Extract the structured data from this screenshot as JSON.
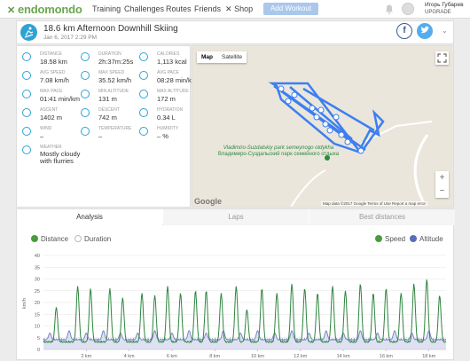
{
  "topbar": {
    "logo": "endomondo",
    "nav": [
      "Training",
      "Challenges",
      "Routes",
      "Friends",
      "Shop"
    ],
    "add_workout": "Add Workout",
    "user_name": "Игорь Губарев",
    "upgrade": "UPGRADE"
  },
  "workout": {
    "title": "18.6 km Afternoon Downhill Skiing",
    "date": "Jan 6, 2017 2:29 PM",
    "facebook": "f",
    "twitter": "t"
  },
  "stats": [
    {
      "label": "DISTANCE",
      "value": "18.58 km",
      "icon": "distance-icon"
    },
    {
      "label": "DURATION",
      "value": "2h:37m:25s",
      "icon": "duration-icon"
    },
    {
      "label": "CALORIES",
      "value": "1,113 kcal",
      "icon": "calories-icon"
    },
    {
      "label": "AVG SPEED",
      "value": "7.08 km/h",
      "icon": "avg-speed-icon"
    },
    {
      "label": "MAX SPEED",
      "value": "35.52 km/h",
      "icon": "max-speed-icon"
    },
    {
      "label": "AVG PACE",
      "value": "08:28 min/km",
      "icon": "avg-pace-icon"
    },
    {
      "label": "MAX PACE",
      "value": "01:41 min/km",
      "icon": "max-pace-icon"
    },
    {
      "label": "MIN ALTITUDE",
      "value": "131 m",
      "icon": "min-altitude-icon"
    },
    {
      "label": "MAX ALTITUDE",
      "value": "172 m",
      "icon": "max-altitude-icon"
    },
    {
      "label": "ASCENT",
      "value": "1402 m",
      "icon": "ascent-icon"
    },
    {
      "label": "DESCENT",
      "value": "742 m",
      "icon": "descent-icon"
    },
    {
      "label": "HYDRATION",
      "value": "0.34 L",
      "icon": "hydration-icon"
    },
    {
      "label": "WIND",
      "value": "–",
      "icon": "wind-icon"
    },
    {
      "label": "TEMPERATURE",
      "value": "–",
      "icon": "temperature-icon"
    },
    {
      "label": "HUMIDITY",
      "value": "– %",
      "icon": "humidity-icon"
    },
    {
      "label": "WEATHER",
      "value": "Mostly cloudy with flurries",
      "icon": "weather-icon"
    }
  ],
  "map": {
    "tab_map": "Map",
    "tab_satellite": "Satellite",
    "poi_line1": "Vladimiro-Suzdalskiy park semeynogo otdykha",
    "poi_line2": "Владимиро-Суздальский парк семейного отдыха",
    "google": "Google",
    "footer": "Map data ©2017 Google   Terms of Use   Report a map error",
    "zoom_in": "+",
    "zoom_out": "−",
    "route_color": "#3d7ff0"
  },
  "analysis": {
    "tabs": [
      "Analysis",
      "Laps",
      "Best distances"
    ],
    "toggle_distance": "Distance",
    "toggle_duration": "Duration",
    "toggle_speed": "Speed",
    "toggle_altitude": "Altitude"
  },
  "chart_data": {
    "type": "line",
    "xlabel": "km",
    "ylabel": "km/h",
    "ylim": [
      0,
      40
    ],
    "yticks": [
      0,
      5,
      10,
      15,
      20,
      25,
      30,
      35,
      40
    ],
    "xticks": [
      "2 km",
      "4 km",
      "6 km",
      "8 km",
      "10 km",
      "12 km",
      "14 km",
      "16 km",
      "18 km"
    ],
    "grid": true,
    "series": [
      {
        "name": "Speed",
        "color": "#2e8540",
        "peaks": [
          [
            0.6,
            18
          ],
          [
            1.6,
            27
          ],
          [
            2.2,
            26
          ],
          [
            3.1,
            26
          ],
          [
            3.7,
            22
          ],
          [
            4.6,
            24
          ],
          [
            5.2,
            23
          ],
          [
            5.8,
            27
          ],
          [
            6.4,
            24
          ],
          [
            7.1,
            25
          ],
          [
            7.6,
            25
          ],
          [
            8.3,
            24
          ],
          [
            9.0,
            27
          ],
          [
            9.5,
            17
          ],
          [
            10.2,
            26
          ],
          [
            10.9,
            24
          ],
          [
            11.6,
            28
          ],
          [
            12.2,
            26
          ],
          [
            12.8,
            24
          ],
          [
            13.5,
            27
          ],
          [
            14.1,
            25
          ],
          [
            14.8,
            28
          ],
          [
            15.4,
            24
          ],
          [
            16.0,
            26
          ],
          [
            16.7,
            24
          ],
          [
            17.3,
            28
          ],
          [
            17.9,
            30
          ],
          [
            18.5,
            23
          ]
        ],
        "base": 3
      },
      {
        "name": "Altitude",
        "color": "#7b86c8",
        "peaks": [
          [
            0.3,
            7
          ],
          [
            1.2,
            8
          ],
          [
            2.0,
            7
          ],
          [
            2.8,
            8
          ],
          [
            3.6,
            7
          ],
          [
            4.4,
            7
          ],
          [
            5.2,
            8
          ],
          [
            6.0,
            7
          ],
          [
            6.8,
            8
          ],
          [
            7.6,
            7
          ],
          [
            8.4,
            8
          ],
          [
            9.2,
            7
          ],
          [
            10.0,
            8
          ],
          [
            10.8,
            7
          ],
          [
            11.6,
            8
          ],
          [
            12.4,
            7
          ],
          [
            13.2,
            8
          ],
          [
            14.0,
            7
          ],
          [
            14.8,
            8
          ],
          [
            15.6,
            7
          ],
          [
            16.4,
            8
          ],
          [
            17.2,
            7
          ],
          [
            18.0,
            8
          ]
        ],
        "base": 4
      }
    ],
    "xlim": [
      0,
      18.8
    ]
  }
}
